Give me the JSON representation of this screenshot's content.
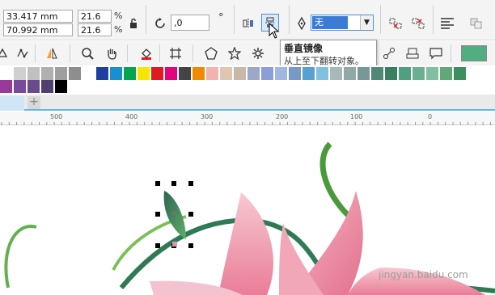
{
  "property_bar": {
    "x_value": "33.417 mm",
    "y_value": "70.992 mm",
    "scale_w": "21.6",
    "scale_h": "21.6",
    "percent_sign": "%",
    "rotation_value": ",0",
    "rotation_unit": "°",
    "outline_value": "无"
  },
  "tooltip": {
    "title": "垂直镜像",
    "description": "从上至下翻转对象。"
  },
  "ruler": {
    "labels": [
      "500",
      "400",
      "300",
      "200",
      "100",
      "0"
    ]
  },
  "tabs": {
    "add_label": "+"
  },
  "palette": {
    "row1": [
      "#ffffff",
      "#d0d0d0",
      "#c0c0c0",
      "#b0b0b0",
      "#9f9f9f",
      "#8e8e8e",
      "#ffffff",
      "#1f3fa0",
      "#1a8fd0",
      "#00a650",
      "#f5e800",
      "#e11a22",
      "#e5007e",
      "#444444",
      "#f08a00",
      "#f2b3b0",
      "#e0c6b0",
      "#c8b8a8",
      "#9ca8c8",
      "#8c9ed8",
      "#a0b8e0",
      "#7898c8",
      "#58a0d0",
      "#80c0e0",
      "#a8b8b8",
      "#90a8a8",
      "#789898",
      "#508878",
      "#3a8060",
      "#50a080",
      "#68b090",
      "#80c0a0",
      "#60a878",
      "#3c9060"
    ],
    "row2": [
      "#9a3a98",
      "#7a4a9a",
      "#6a4a8a",
      "#504070",
      "#000000"
    ]
  },
  "colors": {
    "tab_underline": "#61b7e6",
    "stem": "#3f9a4a",
    "petal_pink": "#ee8aa0",
    "fill_preview": "#52ad7f"
  },
  "watermark": "jingyan.baidu.com",
  "icons": [
    "undo-rotate-icon",
    "mirror-horizontal-icon",
    "mirror-vertical-icon",
    "pen-nib-icon",
    "dropdown-arrow-icon",
    "break-apart-icon",
    "combine-icon",
    "text-wrap-icon",
    "layers-icon"
  ]
}
